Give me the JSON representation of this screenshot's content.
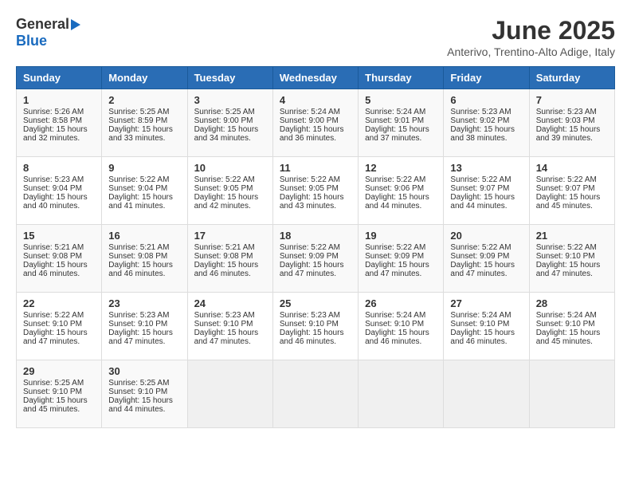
{
  "header": {
    "logo_general": "General",
    "logo_blue": "Blue",
    "title": "June 2025",
    "subtitle": "Anterivo, Trentino-Alto Adige, Italy"
  },
  "calendar": {
    "headers": [
      "Sunday",
      "Monday",
      "Tuesday",
      "Wednesday",
      "Thursday",
      "Friday",
      "Saturday"
    ],
    "weeks": [
      [
        {
          "day": "",
          "empty": true
        },
        {
          "day": "",
          "empty": true
        },
        {
          "day": "",
          "empty": true
        },
        {
          "day": "",
          "empty": true
        },
        {
          "day": "",
          "empty": true
        },
        {
          "day": "",
          "empty": true
        },
        {
          "day": "",
          "empty": true
        }
      ],
      [
        {
          "day": "1",
          "sunrise": "Sunrise: 5:26 AM",
          "sunset": "Sunset: 8:58 PM",
          "daylight": "Daylight: 15 hours and 32 minutes."
        },
        {
          "day": "2",
          "sunrise": "Sunrise: 5:25 AM",
          "sunset": "Sunset: 8:59 PM",
          "daylight": "Daylight: 15 hours and 33 minutes."
        },
        {
          "day": "3",
          "sunrise": "Sunrise: 5:25 AM",
          "sunset": "Sunset: 9:00 PM",
          "daylight": "Daylight: 15 hours and 34 minutes."
        },
        {
          "day": "4",
          "sunrise": "Sunrise: 5:24 AM",
          "sunset": "Sunset: 9:00 PM",
          "daylight": "Daylight: 15 hours and 36 minutes."
        },
        {
          "day": "5",
          "sunrise": "Sunrise: 5:24 AM",
          "sunset": "Sunset: 9:01 PM",
          "daylight": "Daylight: 15 hours and 37 minutes."
        },
        {
          "day": "6",
          "sunrise": "Sunrise: 5:23 AM",
          "sunset": "Sunset: 9:02 PM",
          "daylight": "Daylight: 15 hours and 38 minutes."
        },
        {
          "day": "7",
          "sunrise": "Sunrise: 5:23 AM",
          "sunset": "Sunset: 9:03 PM",
          "daylight": "Daylight: 15 hours and 39 minutes."
        }
      ],
      [
        {
          "day": "8",
          "sunrise": "Sunrise: 5:23 AM",
          "sunset": "Sunset: 9:04 PM",
          "daylight": "Daylight: 15 hours and 40 minutes."
        },
        {
          "day": "9",
          "sunrise": "Sunrise: 5:22 AM",
          "sunset": "Sunset: 9:04 PM",
          "daylight": "Daylight: 15 hours and 41 minutes."
        },
        {
          "day": "10",
          "sunrise": "Sunrise: 5:22 AM",
          "sunset": "Sunset: 9:05 PM",
          "daylight": "Daylight: 15 hours and 42 minutes."
        },
        {
          "day": "11",
          "sunrise": "Sunrise: 5:22 AM",
          "sunset": "Sunset: 9:05 PM",
          "daylight": "Daylight: 15 hours and 43 minutes."
        },
        {
          "day": "12",
          "sunrise": "Sunrise: 5:22 AM",
          "sunset": "Sunset: 9:06 PM",
          "daylight": "Daylight: 15 hours and 44 minutes."
        },
        {
          "day": "13",
          "sunrise": "Sunrise: 5:22 AM",
          "sunset": "Sunset: 9:07 PM",
          "daylight": "Daylight: 15 hours and 44 minutes."
        },
        {
          "day": "14",
          "sunrise": "Sunrise: 5:22 AM",
          "sunset": "Sunset: 9:07 PM",
          "daylight": "Daylight: 15 hours and 45 minutes."
        }
      ],
      [
        {
          "day": "15",
          "sunrise": "Sunrise: 5:21 AM",
          "sunset": "Sunset: 9:08 PM",
          "daylight": "Daylight: 15 hours and 46 minutes."
        },
        {
          "day": "16",
          "sunrise": "Sunrise: 5:21 AM",
          "sunset": "Sunset: 9:08 PM",
          "daylight": "Daylight: 15 hours and 46 minutes."
        },
        {
          "day": "17",
          "sunrise": "Sunrise: 5:21 AM",
          "sunset": "Sunset: 9:08 PM",
          "daylight": "Daylight: 15 hours and 46 minutes."
        },
        {
          "day": "18",
          "sunrise": "Sunrise: 5:22 AM",
          "sunset": "Sunset: 9:09 PM",
          "daylight": "Daylight: 15 hours and 47 minutes."
        },
        {
          "day": "19",
          "sunrise": "Sunrise: 5:22 AM",
          "sunset": "Sunset: 9:09 PM",
          "daylight": "Daylight: 15 hours and 47 minutes."
        },
        {
          "day": "20",
          "sunrise": "Sunrise: 5:22 AM",
          "sunset": "Sunset: 9:09 PM",
          "daylight": "Daylight: 15 hours and 47 minutes."
        },
        {
          "day": "21",
          "sunrise": "Sunrise: 5:22 AM",
          "sunset": "Sunset: 9:10 PM",
          "daylight": "Daylight: 15 hours and 47 minutes."
        }
      ],
      [
        {
          "day": "22",
          "sunrise": "Sunrise: 5:22 AM",
          "sunset": "Sunset: 9:10 PM",
          "daylight": "Daylight: 15 hours and 47 minutes."
        },
        {
          "day": "23",
          "sunrise": "Sunrise: 5:23 AM",
          "sunset": "Sunset: 9:10 PM",
          "daylight": "Daylight: 15 hours and 47 minutes."
        },
        {
          "day": "24",
          "sunrise": "Sunrise: 5:23 AM",
          "sunset": "Sunset: 9:10 PM",
          "daylight": "Daylight: 15 hours and 47 minutes."
        },
        {
          "day": "25",
          "sunrise": "Sunrise: 5:23 AM",
          "sunset": "Sunset: 9:10 PM",
          "daylight": "Daylight: 15 hours and 46 minutes."
        },
        {
          "day": "26",
          "sunrise": "Sunrise: 5:24 AM",
          "sunset": "Sunset: 9:10 PM",
          "daylight": "Daylight: 15 hours and 46 minutes."
        },
        {
          "day": "27",
          "sunrise": "Sunrise: 5:24 AM",
          "sunset": "Sunset: 9:10 PM",
          "daylight": "Daylight: 15 hours and 46 minutes."
        },
        {
          "day": "28",
          "sunrise": "Sunrise: 5:24 AM",
          "sunset": "Sunset: 9:10 PM",
          "daylight": "Daylight: 15 hours and 45 minutes."
        }
      ],
      [
        {
          "day": "29",
          "sunrise": "Sunrise: 5:25 AM",
          "sunset": "Sunset: 9:10 PM",
          "daylight": "Daylight: 15 hours and 45 minutes."
        },
        {
          "day": "30",
          "sunrise": "Sunrise: 5:25 AM",
          "sunset": "Sunset: 9:10 PM",
          "daylight": "Daylight: 15 hours and 44 minutes."
        },
        {
          "day": "",
          "empty": true
        },
        {
          "day": "",
          "empty": true
        },
        {
          "day": "",
          "empty": true
        },
        {
          "day": "",
          "empty": true
        },
        {
          "day": "",
          "empty": true
        }
      ]
    ]
  }
}
